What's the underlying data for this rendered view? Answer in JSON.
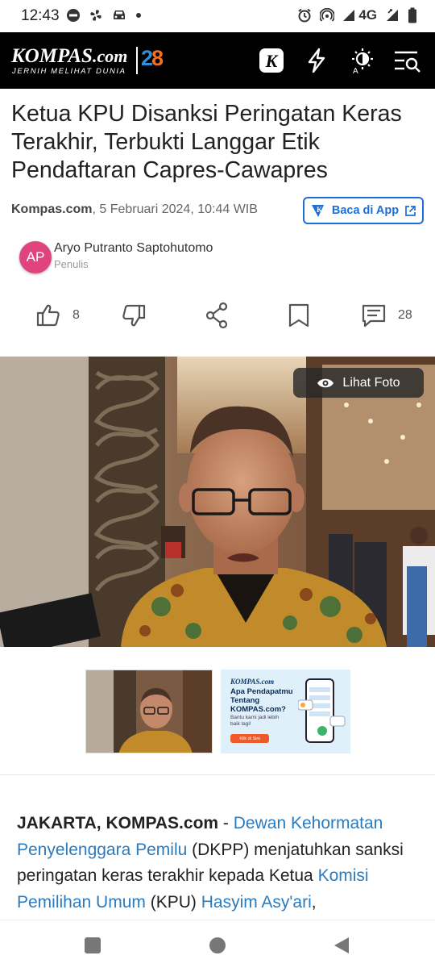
{
  "status_bar": {
    "time": "12:43",
    "network": "4G",
    "left_icons": [
      "do-not-disturb-icon",
      "fan-icon",
      "car-icon",
      "dot-icon"
    ],
    "right_icons": [
      "alarm-icon",
      "hotspot-icon",
      "signal-icon",
      "signal-2-icon",
      "battery-icon"
    ]
  },
  "header": {
    "logo_text": "KOMPAS",
    "logo_suffix": ".com",
    "tagline": "JERNIH MELIHAT DUNIA",
    "anniversary_digit_a": "2",
    "anniversary_digit_b": "8",
    "background_color": "#000000",
    "icons": [
      "kompas-k-icon",
      "lightning-icon",
      "auto-theme-icon",
      "menu-search-icon"
    ]
  },
  "article": {
    "title": "Ketua KPU Disanksi Peringatan Keras Terakhir, Terbukti Langgar Etik Pendaftaran Capres-Cawapres",
    "source": "Kompas.com",
    "datetime": ", 5 Februari 2024, 10:44 WIB",
    "open_app_label": "Baca di App",
    "author": {
      "initials": "AP",
      "name": "Aryo Putranto Saptohutomo",
      "role": "Penulis"
    },
    "actions": {
      "like_count": "8",
      "comment_count": "28"
    },
    "photo": {
      "view_label": "Lihat Foto"
    },
    "ad_banner": {
      "brand": "KOMPAS.com",
      "headline": "Apa Pendapatmu Tentang KOMPAS.com?",
      "subtext": "Bantu kami jadi lebih baik lagi!",
      "cta": "Klik di Sini"
    },
    "body": {
      "dateline": "JAKARTA, KOMPAS.com",
      "sep": " - ",
      "link1": "Dewan Kehormatan Penyelenggara Pemilu",
      "text1": " (DKPP) menjatuhkan sanksi peringatan keras terakhir kepada Ketua ",
      "link2": "Komisi Pemilihan Umum",
      "text2": " (KPU) ",
      "link3": "Hasyim Asy'ari",
      "text3": ","
    }
  },
  "colors": {
    "accent_blue": "#1d6fd6",
    "link_blue": "#2b7bbf",
    "avatar_pink": "#e0447e",
    "logo_orange": "#f36f21"
  }
}
